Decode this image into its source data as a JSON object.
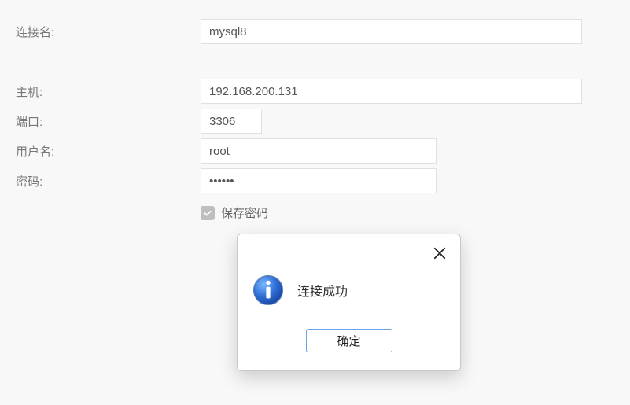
{
  "form": {
    "connection_name_label": "连接名:",
    "connection_name_value": "mysql8",
    "host_label": "主机:",
    "host_value": "192.168.200.131",
    "port_label": "端口:",
    "port_value": "3306",
    "username_label": "用户名:",
    "username_value": "root",
    "password_label": "密码:",
    "password_value": "••••••",
    "save_password_label": "保存密码"
  },
  "dialog": {
    "message": "连接成功",
    "ok_label": "确定"
  }
}
